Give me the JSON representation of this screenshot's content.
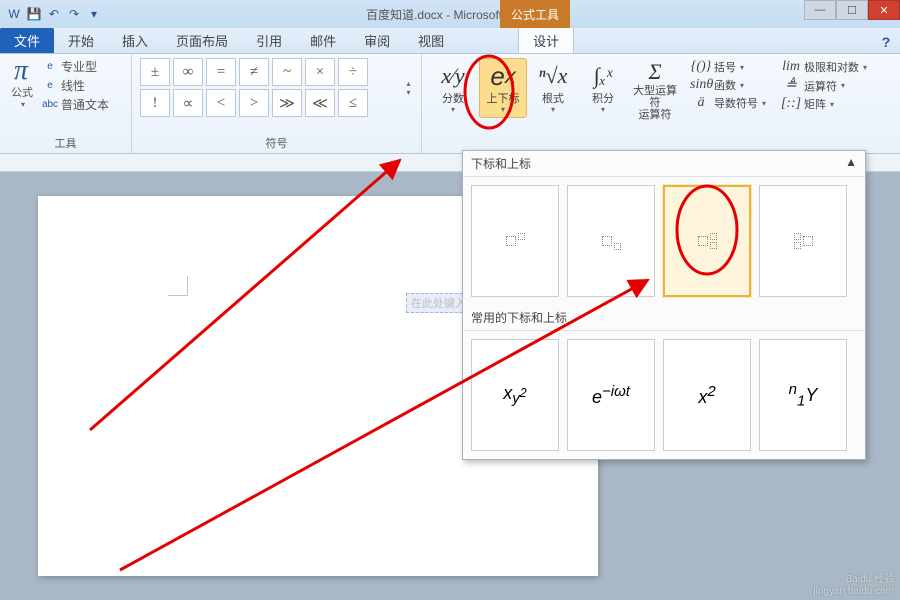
{
  "title": "百度知道.docx - Microsoft Word",
  "equation_tools_tab": "公式工具",
  "win_controls": {
    "help": "?"
  },
  "tabs": {
    "file": "文件",
    "items": [
      "开始",
      "插入",
      "页面布局",
      "引用",
      "邮件",
      "审阅",
      "视图",
      "设计"
    ],
    "active": "设计"
  },
  "tools_group": {
    "label": "工具",
    "formula": "公式",
    "pro": "专业型",
    "linear": "线性",
    "plain": "普通文本"
  },
  "symbols_group": {
    "label": "符号",
    "row1": [
      "±",
      "∞",
      "=",
      "≠",
      "~",
      "×",
      "÷"
    ],
    "row2": [
      "!",
      "∝",
      "<",
      ">",
      "≫",
      "≪",
      "≤"
    ]
  },
  "structs": {
    "fraction": {
      "glyph": "x⁄y",
      "label": "分数"
    },
    "script": {
      "glyph": "eˣ",
      "label": "上下标"
    },
    "radical": {
      "glyph": "ⁿ√x",
      "label": "根式"
    },
    "integral": {
      "glyph": "∫ₓˣ",
      "label": "积分"
    },
    "largeop": {
      "glyph": "Σ",
      "label": "大型运算符",
      "label2": "运算符"
    },
    "bracket": {
      "glyph": "{()}",
      "label": "括号"
    },
    "function": {
      "glyph": "sinθ",
      "label": "函数"
    },
    "accent": {
      "glyph": "ä",
      "label": "导数符号"
    },
    "limit": {
      "glyph": "lim",
      "label": "极限和对数"
    },
    "operator": {
      "glyph": "≜",
      "label": "运算符"
    },
    "matrix": {
      "glyph": "[::]",
      "label": "矩阵"
    }
  },
  "placeholder_text": "在此处键入公",
  "dropdown": {
    "section1": "下标和上标",
    "section2": "常用的下标和上标",
    "common": [
      "x_{y²}",
      "e^{−iωt}",
      "x²",
      "ⁿ₁Y"
    ]
  },
  "watermark": {
    "top": "Baidu 经验",
    "bottom": "jingyan.baidu.com"
  }
}
